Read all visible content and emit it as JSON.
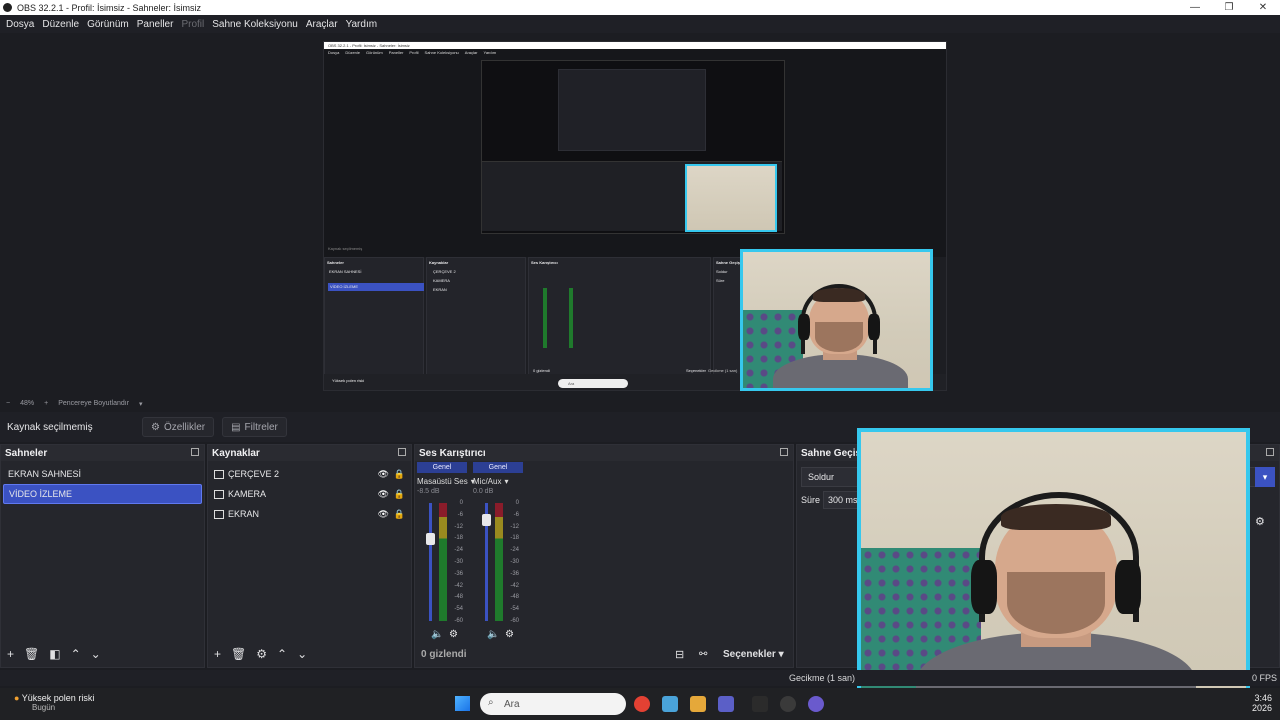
{
  "window": {
    "title": "OBS 32.2.1 - Profil: İsimsiz - Sahneler: İsimsiz"
  },
  "menu": [
    "Dosya",
    "Düzenle",
    "Görünüm",
    "Paneller",
    "Profil",
    "Sahne Koleksiyonu",
    "Araçlar",
    "Yardım"
  ],
  "nested_preview": {
    "title": "OBS 32.2.1 - Profil: İsimsiz - Sahneler: İsimsiz",
    "menu": [
      "Dosya",
      "Düzenle",
      "Görünüm",
      "Paneller",
      "Profil",
      "Sahne Koleksiyonu",
      "Araçlar",
      "Yardım"
    ],
    "no_source": "Kaynak seçilmemiş",
    "scenes_title": "Sahneler",
    "sources_title": "Kaynaklar",
    "mixer_title": "Ses Karıştırıcı",
    "transitions_title": "Sahne Geçişi",
    "scenes": [
      "EKRAN SAHNESİ",
      "VİDEO İZLEME"
    ],
    "sources": [
      "ÇERÇEVE 2",
      "KAMERA",
      "EKRAN"
    ],
    "hidden": "0 gizlendi",
    "options": "Seçenekler",
    "transition": "Soldur",
    "duration_label": "Süre",
    "duration": "300 ms",
    "delay": "Gecikme (1 san)",
    "weather": "Yüksek polen riski",
    "weather_sub": "Bugün",
    "search": "Ara"
  },
  "zoom": {
    "minus": "−",
    "value": "48%",
    "plus": "+",
    "fit": "Pencereye Boyutlandır"
  },
  "context": {
    "no_source": "Kaynak seçilmemiş",
    "properties": "Özellikler",
    "filters": "Filtreler"
  },
  "scenes": {
    "title": "Sahneler",
    "items": [
      "EKRAN SAHNESİ",
      "VİDEO İZLEME"
    ],
    "selected": 1
  },
  "sources": {
    "title": "Kaynaklar",
    "items": [
      "ÇERÇEVE 2",
      "KAMERA",
      "EKRAN"
    ]
  },
  "mixer": {
    "title": "Ses Karıştırıcı",
    "channels": [
      {
        "tag": "Genel",
        "name": "Masaüstü Ses",
        "db": "-8.5 dB",
        "level": 0.72
      },
      {
        "tag": "Genel",
        "name": "Mic/Aux",
        "db": "0.0 dB",
        "level": 0.9
      }
    ],
    "scale": [
      "0",
      "-6",
      "-12",
      "-18",
      "-24",
      "-30",
      "-36",
      "-42",
      "-48",
      "-54",
      "-60"
    ],
    "hidden": "0 gizlendi",
    "options": "Seçenekler"
  },
  "transitions": {
    "title": "Sahne Geçişi",
    "type": "Soldur",
    "duration_label": "Süre",
    "duration": "300 ms"
  },
  "status": {
    "delay": "Gecikme (1 san)",
    "fps": "0 FPS"
  },
  "taskbar": {
    "weather": "Yüksek polen riski",
    "weather_sub": "Bugün",
    "search": "Ara",
    "time": "3:46",
    "date": "2026"
  },
  "colors": {
    "accent": "#3b52c2",
    "frame": "#36c8ee",
    "panel": "#25262c"
  }
}
